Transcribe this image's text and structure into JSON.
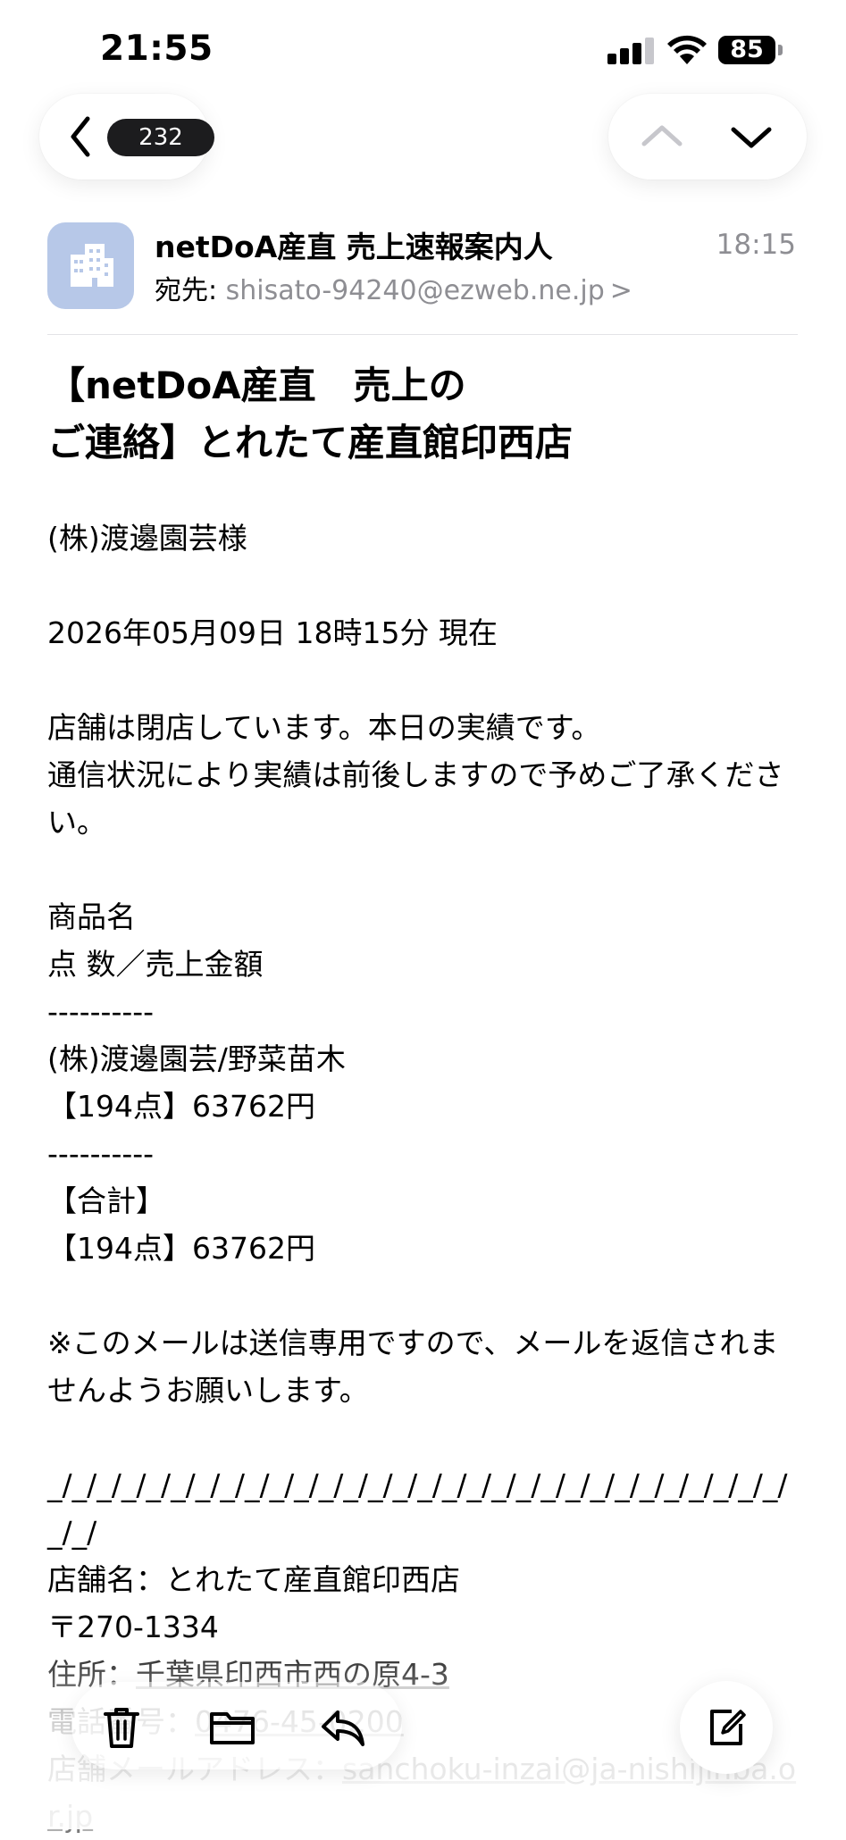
{
  "status_bar": {
    "time": "21:55",
    "battery": "85"
  },
  "nav": {
    "unread_count": "232"
  },
  "header": {
    "sender": "netDoA産直 売上速報案内人",
    "time": "18:15",
    "to_label": "宛先:",
    "to_address": "shisato-94240@ezweb.ne.jp",
    "to_chevron": ">"
  },
  "subject": {
    "line1": "【netDoA産直　売上の",
    "line2": "ご連絡】とれたて産直館印西店"
  },
  "body": {
    "addressee": "(株)渡邊園芸様",
    "datetime": "2026年05月09日 18時15分 現在",
    "notice1": "店舗は閉店しています。本日の実績です。",
    "notice2": "通信状況により実績は前後しますので予めご了承ください。",
    "col_header1": "商品名",
    "col_header2": "点 数／売上金額",
    "sep1": "----------",
    "item_name": "(株)渡邊園芸/野菜苗木",
    "item_value": "【194点】63762円",
    "sep2": "----------",
    "total_label": "【合計】",
    "total_value": "【194点】63762円",
    "noreply": "※このメールは送信専用ですので、メールを返信されませんようお願いします。",
    "rule": "_/_/_/_/_/_/_/_/_/_/_/_/_/_/_/_/_/_/_/_/_/_/_/_/_/_/_/_/_/_/_/_/",
    "shop_name": "店舗名：とれたて産直館印西店",
    "postal": "〒270-1334",
    "address_label": "住所：",
    "address_value": "千葉県印西市西の原4-3",
    "phone_label": "電話番号：",
    "phone_value": "0476-45-0200",
    "email_label": "店舗メールアドレス：",
    "email_value": "sanchoku-inzai@ja-nishijinba.or.jp"
  },
  "icons": {
    "back": "chevron-left-icon",
    "prev": "chevron-up-icon",
    "next": "chevron-down-icon",
    "trash": "trash-icon",
    "folder": "folder-icon",
    "reply": "reply-icon",
    "compose": "compose-icon",
    "avatar": "building-icon"
  },
  "colors": {
    "avatar_bg": "#b7c8e8",
    "badge_bg": "#1c1c1e",
    "muted": "#8e8e93"
  }
}
